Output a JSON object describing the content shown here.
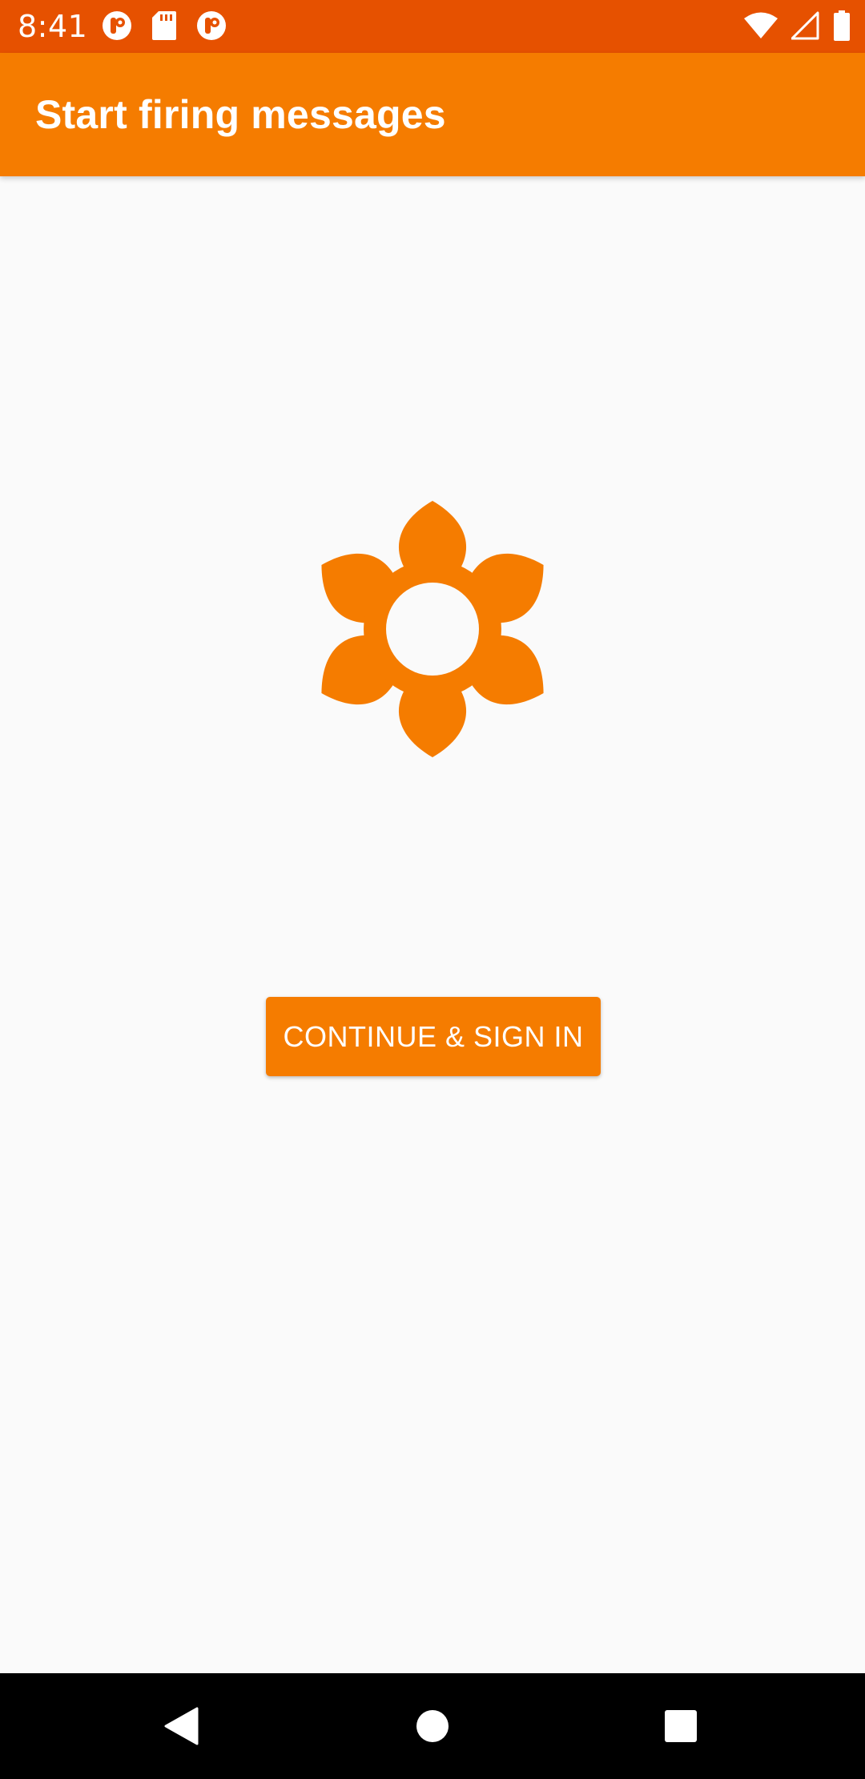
{
  "status_bar": {
    "time": "8:41",
    "notification_icons": [
      "pinterest-icon",
      "sd-card-icon",
      "pinterest-icon"
    ],
    "system_icons": [
      "wifi-icon",
      "cell-signal-icon",
      "battery-icon"
    ],
    "background_color": "#e65100"
  },
  "app_bar": {
    "title": "Start firing messages",
    "background_color": "#f57c00"
  },
  "main": {
    "logo_icon": "flower-icon",
    "logo_color": "#f57c00",
    "continue_button_label": "CONTINUE & SIGN IN"
  },
  "nav_bar": {
    "buttons": [
      "back-icon",
      "home-icon",
      "recents-icon"
    ]
  }
}
